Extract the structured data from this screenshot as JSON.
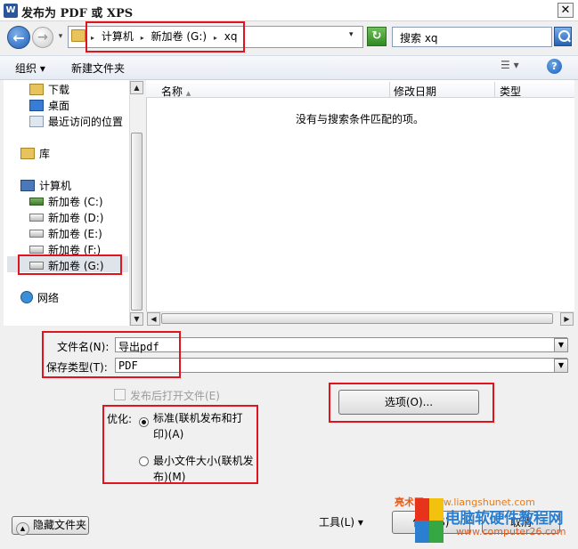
{
  "window": {
    "app_icon_letter": "W",
    "title": "发布为 PDF 或 XPS",
    "close_glyph": "✕"
  },
  "address": {
    "back_glyph": "←",
    "forward_glyph": "→",
    "history_glyph": "▾",
    "crumbs": [
      "计算机",
      "新加卷 (G:)",
      "xq"
    ],
    "crumb_sep": "▸",
    "dropdown_glyph": "▾",
    "refresh_glyph": "↻",
    "search_placeholder": "搜索 xq"
  },
  "toolbar": {
    "organize_label": "组织 ▾",
    "new_folder_label": "新建文件夹",
    "view_glyph": "☰ ▾",
    "help_glyph": "?"
  },
  "nav": {
    "favorites": [
      {
        "label": "下载",
        "icon": "download-icon"
      },
      {
        "label": "桌面",
        "icon": "desktop-icon"
      },
      {
        "label": "最近访问的位置",
        "icon": "recent-places-icon"
      }
    ],
    "library_label": "库",
    "computer_label": "计算机",
    "drives": [
      {
        "label": "新加卷 (C:)",
        "icon": "system-drive-icon"
      },
      {
        "label": "新加卷 (D:)",
        "icon": "drive-icon"
      },
      {
        "label": "新加卷 (E:)",
        "icon": "drive-icon"
      },
      {
        "label": "新加卷 (F:)",
        "icon": "drive-icon"
      },
      {
        "label": "新加卷 (G:)",
        "icon": "drive-icon",
        "selected": true
      }
    ],
    "network_label": "网络"
  },
  "filelist": {
    "columns": [
      "名称",
      "修改日期",
      "类型"
    ],
    "sort_glyph": "▲",
    "empty_message": "没有与搜索条件匹配的项。"
  },
  "form": {
    "filename_label": "文件名(N):",
    "filename_value": "导出pdf",
    "savetype_label": "保存类型(T):",
    "savetype_value": "PDF",
    "open_after_label": "发布后打开文件(E)",
    "optimize_label": "优化:",
    "options": [
      {
        "label": "标准(联机发布和打印)(A)",
        "checked": true
      },
      {
        "label": "最小文件大小(联机发布)(M)",
        "checked": false
      }
    ],
    "options_button": "选项(O)..."
  },
  "footer": {
    "hide_folders": "隐藏文件夹",
    "tools_label": "工具(L)  ▾",
    "save_label": "保存(S)",
    "cancel_label": "取消"
  },
  "watermark": {
    "site_cn": "亮术网",
    "site_url": "www.liangshunet.com",
    "main_text": "电脑软硬件教程网",
    "url2": "www.computer26.com"
  },
  "colors": {
    "annotation_red": "#e0141e",
    "accent_blue": "#1d5fb8"
  }
}
